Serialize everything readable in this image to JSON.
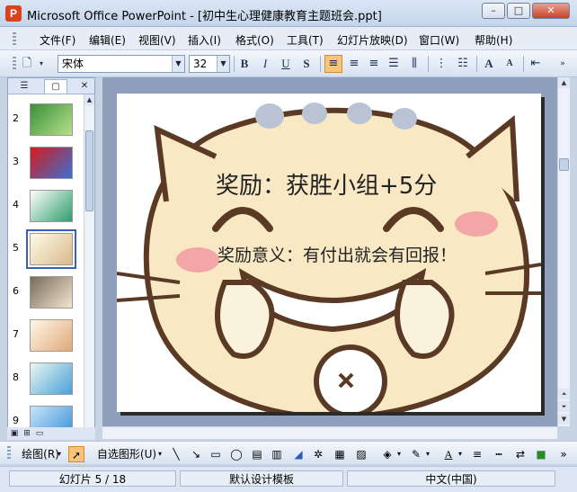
{
  "window": {
    "title": "Microsoft Office PowerPoint - [初中生心理健康教育主题班会.ppt]"
  },
  "menu": [
    "文件(F)",
    "编辑(E)",
    "视图(V)",
    "插入(I)",
    "格式(O)",
    "工具(T)",
    "幻灯片放映(D)",
    "窗口(W)",
    "帮助(H)"
  ],
  "toolbar": {
    "font_name": "宋体",
    "font_size": "32",
    "bold": "B",
    "italic": "I",
    "underline": "U",
    "shadow": "S",
    "grow_font": "A",
    "shrink_font": "A"
  },
  "panel": {
    "tabs": [
      "outline-tab",
      "slides-tab"
    ],
    "thumbnails": [
      {
        "number": "2",
        "colors": [
          "#3a8f3a",
          "#b7e08a"
        ]
      },
      {
        "number": "3",
        "colors": [
          "#d41c1c",
          "#3b6fd1"
        ]
      },
      {
        "number": "4",
        "colors": [
          "#ffffff",
          "#2f9c6a"
        ]
      },
      {
        "number": "5",
        "colors": [
          "#fffbe8",
          "#d9b98c"
        ]
      },
      {
        "number": "6",
        "colors": [
          "#7a6a5a",
          "#f2e6d0"
        ]
      },
      {
        "number": "7",
        "colors": [
          "#fff7e8",
          "#e0a87a"
        ]
      },
      {
        "number": "8",
        "colors": [
          "#e8f7f0",
          "#4aa0d8"
        ]
      },
      {
        "number": "9",
        "colors": [
          "#c8e4f8",
          "#3a8fd8"
        ]
      }
    ],
    "selected_slide": "5"
  },
  "slide": {
    "title": "奖励：获胜小组+5分",
    "subtitle": "奖励意义：有付出就会有回报！"
  },
  "drawbar": {
    "draw_label": "绘图(R)",
    "autoshapes_label": "自选图形(U)"
  },
  "status": {
    "slide_position": "幻灯片 5 / 18",
    "design": "默认设计模板",
    "language": "中文(中国)"
  },
  "colors": {
    "accent": "#f7c47a",
    "selection": "#3a5fb8"
  }
}
